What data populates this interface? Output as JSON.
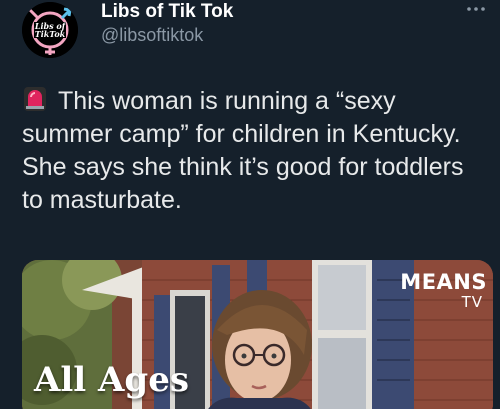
{
  "author": {
    "display_name": "Libs of Tik Tok",
    "handle": "@libsoftiktok",
    "avatar_text": "Libs of TikTok"
  },
  "tweet": {
    "icon": "police-siren-icon",
    "text": "This woman is running a “sexy summer camp” for children in Kentucky. She says she think it’s good for toddlers to masturbate."
  },
  "media": {
    "caption": "All Ages",
    "watermark_line1": "MEANS",
    "watermark_line2": "TV"
  },
  "menu": {
    "icon": "more-options-icon"
  },
  "colors": {
    "background": "#15202b",
    "text": "#e7e9ea",
    "secondary_text": "#8b98a5"
  }
}
